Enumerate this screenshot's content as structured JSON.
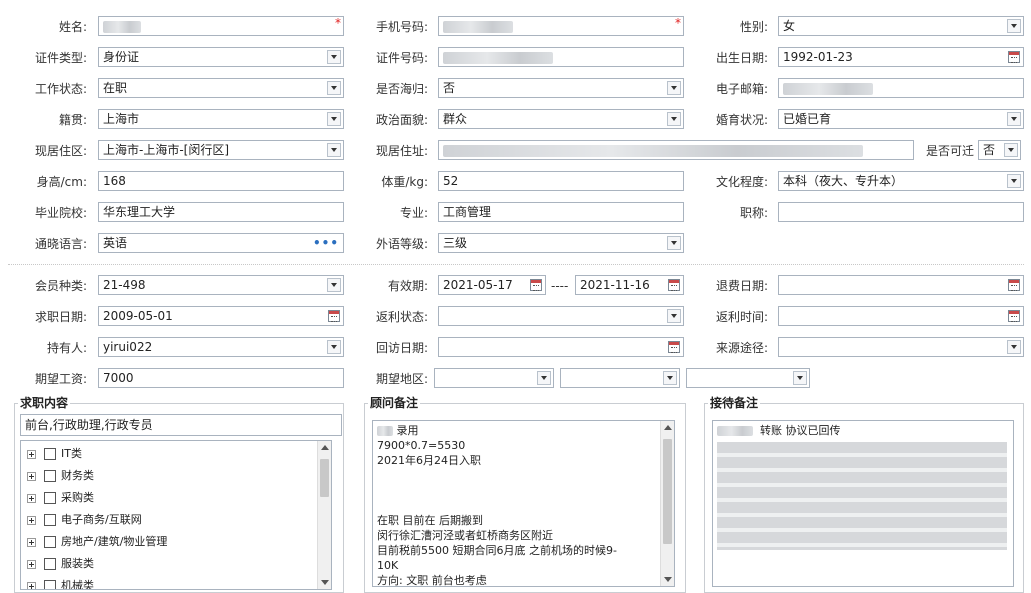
{
  "personal": {
    "name": {
      "label": "姓名:",
      "value": "",
      "required_mark": "*"
    },
    "mobile": {
      "label": "手机号码:",
      "value": "",
      "required_mark": "*"
    },
    "gender": {
      "label": "性别:",
      "value": "女"
    },
    "id_type": {
      "label": "证件类型:",
      "value": "身份证"
    },
    "id_number": {
      "label": "证件号码:",
      "value": ""
    },
    "birth_date": {
      "label": "出生日期:",
      "value": "1992-01-23"
    },
    "work_status": {
      "label": "工作状态:",
      "value": "在职"
    },
    "returnee": {
      "label": "是否海归:",
      "value": "否"
    },
    "email": {
      "label": "电子邮箱:",
      "value": ""
    },
    "native_place": {
      "label": "籍贯:",
      "value": "上海市"
    },
    "political": {
      "label": "政治面貌:",
      "value": "群众"
    },
    "marital": {
      "label": "婚育状况:",
      "value": "已婚已育"
    },
    "residence_area": {
      "label": "现居住区:",
      "value": "上海市-上海市-[闵行区]"
    },
    "residence_address": {
      "label": "现居住址:",
      "value": ""
    },
    "relocate": {
      "label": "是否可迁",
      "value": "否"
    },
    "height": {
      "label": "身高/cm:",
      "value": "168"
    },
    "weight": {
      "label": "体重/kg:",
      "value": "52"
    },
    "education": {
      "label": "文化程度:",
      "value": "本科（夜大、专升本）"
    },
    "school": {
      "label": "毕业院校:",
      "value": "华东理工大学"
    },
    "major": {
      "label": "专业:",
      "value": "工商管理"
    },
    "title": {
      "label": "职称:",
      "value": ""
    },
    "language": {
      "label": "通晓语言:",
      "value": "英语",
      "more": "•••"
    },
    "foreign_level": {
      "label": "外语等级:",
      "value": "三级"
    }
  },
  "membership": {
    "member_type": {
      "label": "会员种类:",
      "value": "21-498"
    },
    "valid_period": {
      "label": "有效期:",
      "start": "2021-05-17",
      "sep": "----",
      "end": "2021-11-16"
    },
    "refund_date": {
      "label": "退费日期:",
      "value": ""
    },
    "job_seek_date": {
      "label": "求职日期:",
      "value": "2009-05-01"
    },
    "rebate_status": {
      "label": "返利状态:",
      "value": ""
    },
    "rebate_time": {
      "label": "返利时间:",
      "value": ""
    },
    "holder": {
      "label": "持有人:",
      "value": "yirui022"
    },
    "revisit_date": {
      "label": "回访日期:",
      "value": ""
    },
    "source": {
      "label": "来源途径:",
      "value": ""
    },
    "expected_salary": {
      "label": "期望工资:",
      "value": "7000"
    },
    "expected_area": {
      "label": "期望地区:",
      "values": [
        "",
        "",
        ""
      ]
    }
  },
  "job_content": {
    "title": "求职内容",
    "selected": "前台,行政助理,行政专员",
    "tree": [
      "IT类",
      "财务类",
      "采购类",
      "电子商务/互联网",
      "房地产/建筑/物业管理",
      "服装类",
      "机械类"
    ]
  },
  "consultant_notes": {
    "title": "顾问备注",
    "lines": [
      "录用",
      "7900*0.7=5530",
      "2021年6月24日入职",
      "",
      "",
      "",
      "在职  目前在           后期搬到",
      "闵行徐汇漕河泾或者虹桥商务区附近",
      "目前税前5500 短期合同6月底   之前机场的时候9-",
      "10K",
      "方向: 文职 前台也考虑"
    ]
  },
  "reception_notes": {
    "title": "接待备注",
    "first_line": "转账 协议已回传"
  },
  "colors": {
    "required": "#e02020",
    "border": "#a9b3bf",
    "more_dots": "#2b6fbf"
  }
}
